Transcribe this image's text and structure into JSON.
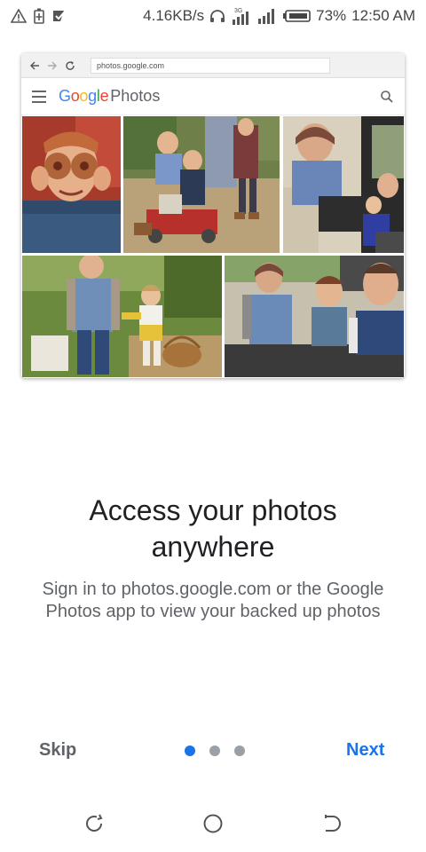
{
  "status_bar": {
    "net_speed": "4.16KB/s",
    "network_type": "3G",
    "battery": "73%",
    "time": "12:50 AM",
    "icons": [
      "warning-icon",
      "battery-saver-icon",
      "check-icon",
      "headphones-icon",
      "signal-3g-icon",
      "signal-icon",
      "battery-icon"
    ]
  },
  "browser_mock": {
    "url": "photos.google.com",
    "logo_brand": "Google",
    "logo_product": "Photos",
    "logo_colors": [
      "#4285F4",
      "#EA4335",
      "#FBBC05",
      "#4285F4",
      "#34A853",
      "#EA4335"
    ],
    "photos": [
      "boy-with-donuts",
      "family-with-wagon",
      "grandma-in-car",
      "parent-and-child-walking",
      "family-selfie-in-car"
    ]
  },
  "onboarding": {
    "title": "Access your photos anywhere",
    "subtitle": "Sign in to photos.google.com or the Google Photos app to view your backed up photos",
    "page_index": 0,
    "page_count": 3
  },
  "buttons": {
    "skip": "Skip",
    "next": "Next"
  },
  "colors": {
    "accent": "#1a73e8",
    "dot_inactive": "#9aa0a6",
    "text_primary": "#202124",
    "text_secondary": "#5f6368"
  },
  "system_nav": [
    "back-icon",
    "home-icon",
    "recents-icon"
  ]
}
